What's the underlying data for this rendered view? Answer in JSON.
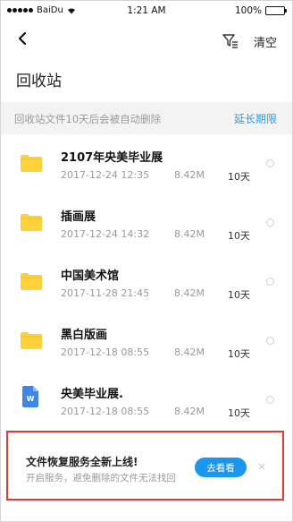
{
  "status_bar": {
    "carrier": "BaiDu",
    "time": "1:21 AM",
    "battery": "100%"
  },
  "nav": {
    "back_icon": "chevron-left-icon",
    "filter_icon": "filter-icon",
    "clear_label": "清空"
  },
  "page": {
    "title": "回收站"
  },
  "notice": {
    "message": "回收站文件10天后会被自动删除",
    "extend_label": "延长期限"
  },
  "files": [
    {
      "name": "2107年央美毕业展",
      "date": "2017-12-24 12:35",
      "size": "8.42M",
      "days_left": "10天",
      "icon": "folder-icon"
    },
    {
      "name": "插画展",
      "date": "2017-12-24 14:32",
      "size": "8.42M",
      "days_left": "10天",
      "icon": "folder-icon"
    },
    {
      "name": "中国美术馆",
      "date": "2017-11-28 21:45",
      "size": "8.42M",
      "days_left": "10天",
      "icon": "folder-icon"
    },
    {
      "name": "黑白版画",
      "date": "2017-12-18 08:55",
      "size": "8.42M",
      "days_left": "10天",
      "icon": "folder-icon"
    },
    {
      "name": "央美毕业展.",
      "date": "2017-12-18 08:55",
      "size": "8.42M",
      "days_left": "10天",
      "icon": "word-doc-icon",
      "doc_letter": "W"
    }
  ],
  "promo": {
    "title": "文件恢复服务全新上线!",
    "subtitle": "开启服务，避免删除的文件无法找回",
    "button_label": "去看看",
    "close_glyph": "×"
  },
  "colors": {
    "accent": "#2f9be8",
    "button": "#1a96ef",
    "folder": "#ffd23b",
    "highlight_border": "#e53935",
    "notice_bg": "#f3f3f3"
  }
}
